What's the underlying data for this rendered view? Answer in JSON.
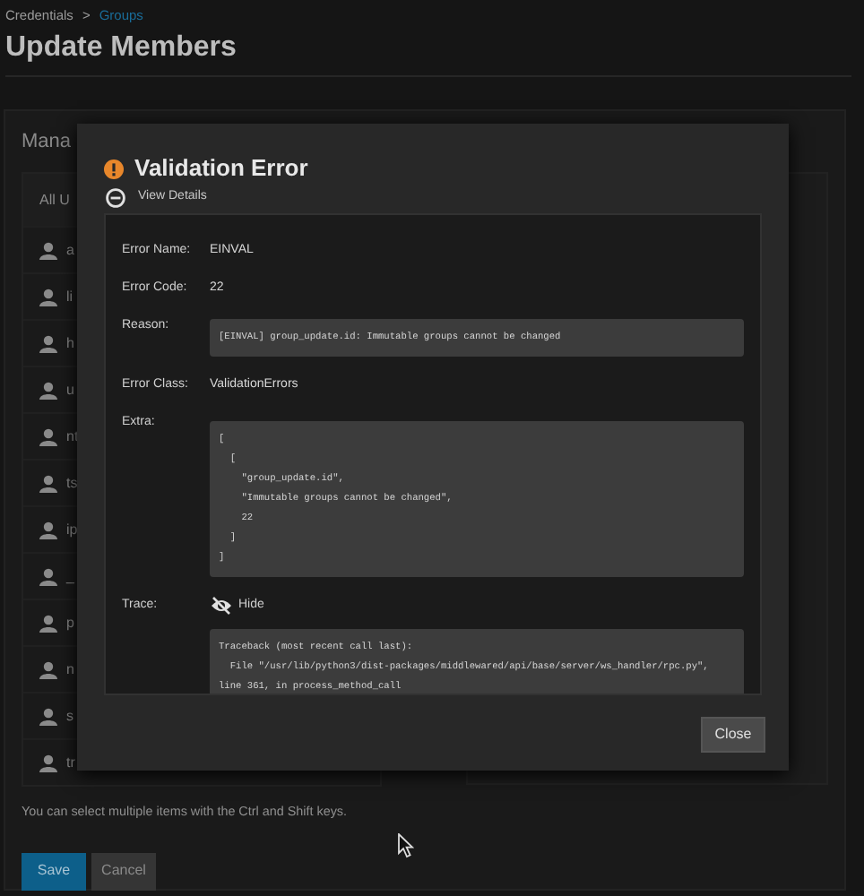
{
  "breadcrumb": [
    {
      "label": "Credentials",
      "link": false
    },
    {
      "label": "Groups",
      "link": true
    }
  ],
  "breadcrumb_separator": ">",
  "title": "Update Members",
  "card": {
    "title": "Mana",
    "list_header": "All U",
    "users": [
      "a",
      "li",
      "h",
      "u",
      "nt",
      "ts",
      "ip",
      "_",
      "p",
      "n",
      "s",
      "tr"
    ],
    "hint": "You can select multiple items with the Ctrl and Shift keys."
  },
  "buttons": [
    {
      "label": "Save",
      "kind": "primary"
    },
    {
      "label": "Cancel",
      "kind": "secondary"
    }
  ],
  "dialog": {
    "title": "Validation Error",
    "details_toggle": {
      "label": "View Details",
      "expanded": true
    },
    "fields": [
      {
        "label": "Error Name:",
        "kind": "text",
        "value": "EINVAL"
      },
      {
        "label": "Error Code:",
        "kind": "text",
        "value": "22"
      },
      {
        "label": "Reason:",
        "kind": "code",
        "lines": [
          "[EINVAL] group_update.id: Immutable groups cannot be changed"
        ]
      },
      {
        "label": "Error Class:",
        "kind": "text",
        "value": "ValidationErrors"
      },
      {
        "label": "Extra:",
        "kind": "code",
        "lines": [
          "[",
          "  [",
          "    \"group_update.id\",",
          "    \"Immutable groups cannot be changed\",",
          "    22",
          "  ]",
          "]"
        ]
      },
      {
        "label": "Trace:",
        "kind": "trace",
        "toggle": {
          "label": "Hide",
          "expanded": true
        },
        "lines": [
          "Traceback (most recent call last):",
          "  File \"/usr/lib/python3/dist-packages/middlewared/api/base/server/ws_handler/rpc.py\",",
          "line 361, in process_method_call"
        ]
      }
    ],
    "close_label": "Close"
  }
}
